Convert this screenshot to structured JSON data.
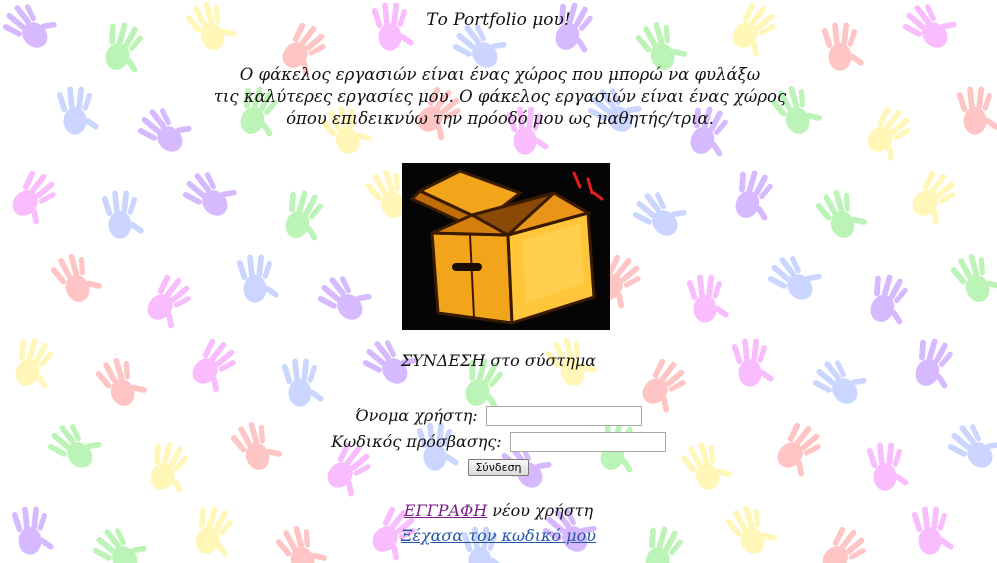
{
  "page": {
    "title": "Το Portfolio μου!",
    "intro_lines": [
      "Ο φάκελος εργασιών είναι ένας χώρος που μπορώ να φυλάξω",
      "τις καλύτερες εργασίες μου. Ο φάκελος εργασιών είναι ένας χώρος",
      "όπου επιδεικνύω την πρόοδό μου ως μαθητής/τρια."
    ]
  },
  "image": {
    "icon": "open-box-icon",
    "colors": {
      "background": "#050505",
      "box_main": "#f2a51b",
      "box_dark": "#c06d08",
      "box_light": "#ffd45a",
      "outline": "#3a1a00",
      "accent": "#e02020"
    }
  },
  "login": {
    "heading": "ΣΥΝΔΕΣΗ στο σύστημα",
    "username_label": "Όνομα χρήστη:",
    "username_value": "",
    "password_label": "Κωδικός πρόσβασης:",
    "password_value": "",
    "submit_label": "Σύνδεση"
  },
  "links": {
    "register_link": "ΕΓΓΡΑΦΗ",
    "register_suffix": " νέου χρήστη",
    "forgot_password": "Ξέχασα τον κωδικό μου"
  },
  "background": {
    "pattern": "colorful-handprints",
    "colors": [
      "#c8a2ff",
      "#a6f0a0",
      "#fff3a0",
      "#ffb0b0",
      "#f6a6ff",
      "#b8c8ff"
    ]
  }
}
